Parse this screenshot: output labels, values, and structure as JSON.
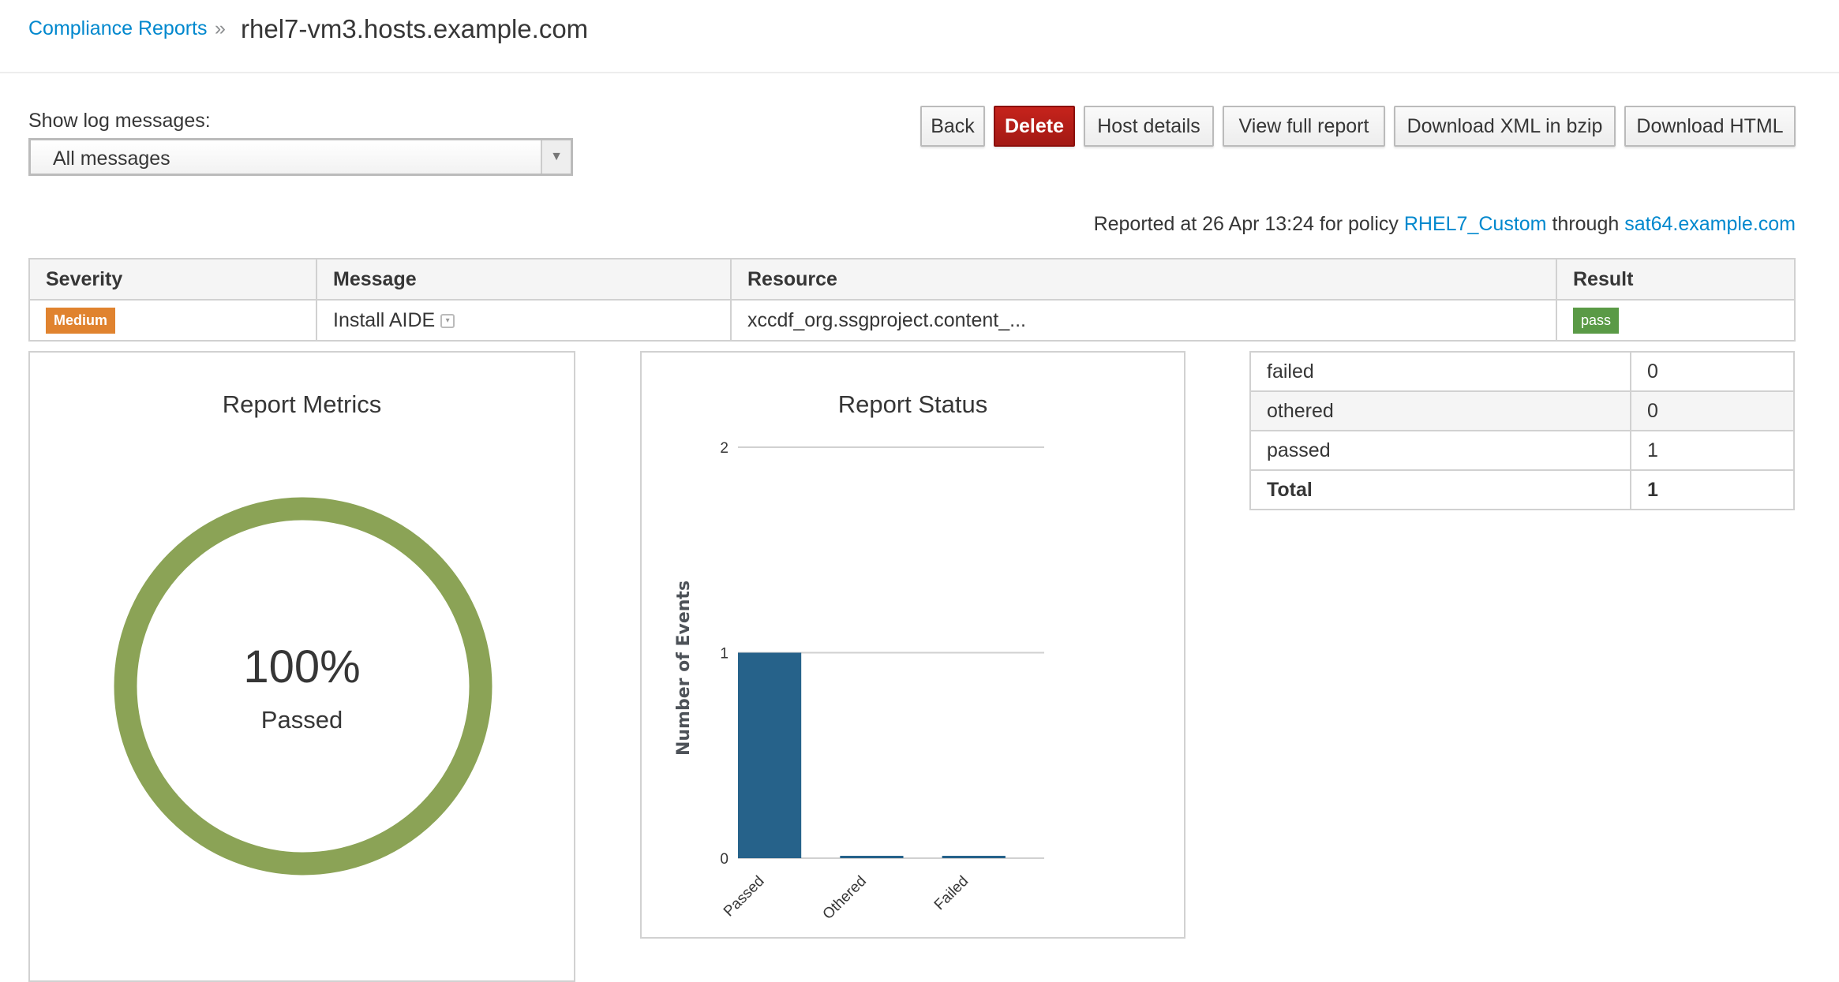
{
  "breadcrumb": {
    "parent": "Compliance Reports",
    "separator": "»",
    "current": "rhel7-vm3.hosts.example.com"
  },
  "filter": {
    "label": "Show log messages:",
    "selected": "All messages"
  },
  "buttons": {
    "back": "Back",
    "delete": "Delete",
    "host_details": "Host details",
    "view_full_report": "View full report",
    "download_xml": "Download XML in bzip",
    "download_html": "Download HTML"
  },
  "reported": {
    "prefix": "Reported at 26 Apr 13:24 for policy",
    "policy": "RHEL7_Custom",
    "middle": "through",
    "proxy": "sat64.example.com"
  },
  "log_table": {
    "headers": [
      "Severity",
      "Message",
      "Resource",
      "Result"
    ],
    "rows": [
      {
        "severity": "Medium",
        "message": "Install AIDE",
        "resource": "xccdf_org.ssgproject.content_...",
        "result": "pass"
      }
    ]
  },
  "metrics": {
    "title": "Report Metrics",
    "percent": "100%",
    "label": "Passed",
    "passed_fraction": 1.0
  },
  "chart_data": {
    "type": "bar",
    "title": "Report Status",
    "ylabel": "Number of Events",
    "categories": [
      "Passed",
      "Othered",
      "Failed"
    ],
    "values": [
      1,
      0,
      0
    ],
    "ylim": [
      0,
      2
    ],
    "yticks": [
      0,
      1,
      2
    ],
    "grid": true
  },
  "summary": {
    "rows": [
      {
        "label": "failed",
        "value": "0"
      },
      {
        "label": "othered",
        "value": "0"
      },
      {
        "label": "passed",
        "value": "1"
      }
    ],
    "total": {
      "label": "Total",
      "value": "1"
    }
  },
  "colors": {
    "link": "#0088ce",
    "danger": "#a91a15",
    "medium": "#e0832f",
    "pass": "#5a9a46",
    "donut": "#8ba356",
    "bar": "#26628a"
  }
}
